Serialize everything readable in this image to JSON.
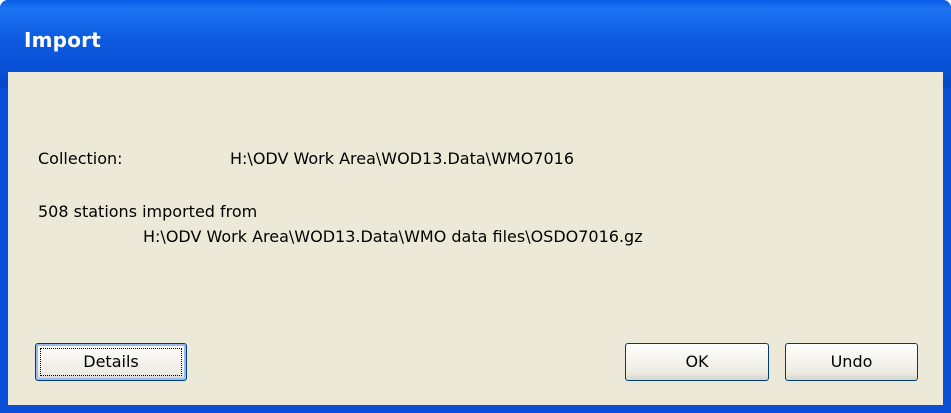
{
  "window": {
    "title": "Import"
  },
  "collection": {
    "label": "Collection:",
    "path": "H:\\ODV Work Area\\WOD13.Data\\WMO7016"
  },
  "import_result": {
    "summary": "508 stations imported from",
    "source_path": "H:\\ODV Work Area\\WOD13.Data\\WMO data files\\OSDO7016.gz"
  },
  "buttons": {
    "details": "Details",
    "ok": "OK",
    "undo": "Undo"
  }
}
